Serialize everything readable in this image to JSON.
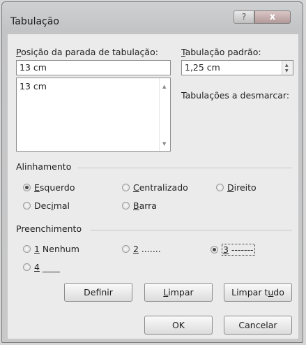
{
  "dialog": {
    "title": "Tabulação",
    "help_glyph": "?",
    "close_glyph": "x"
  },
  "tab_stop": {
    "label_first": "P",
    "label_rest": "osição da parada de tabulação:",
    "value": "13 cm",
    "list": [
      "13 cm"
    ]
  },
  "default_tab": {
    "label_first": "T",
    "label_rest": "abulação padrão:",
    "value": "1,25 cm"
  },
  "clear_label": "Tabulações a desmarcar:",
  "alignment": {
    "legend": "Alinhamento",
    "options": [
      {
        "key": "E",
        "rest": "squerdo",
        "pre": "",
        "checked": true
      },
      {
        "key": "C",
        "rest": "entralizado",
        "pre": "",
        "checked": false
      },
      {
        "key": "D",
        "rest": "ireito",
        "pre": "",
        "checked": false
      },
      {
        "key": "i",
        "rest": "mal",
        "pre": "Dec",
        "checked": false
      },
      {
        "key": "B",
        "rest": "arra",
        "pre": "",
        "checked": false
      }
    ]
  },
  "leader": {
    "legend": "Preenchimento",
    "options": [
      {
        "key": "1",
        "rest": " Nenhum",
        "checked": false
      },
      {
        "key": "2",
        "rest": " .......",
        "checked": false
      },
      {
        "key": "3",
        "rest": " -------",
        "checked": true
      },
      {
        "key": "4",
        "rest": " ____",
        "checked": false
      }
    ]
  },
  "buttons": {
    "set_pre": "Def",
    "set_key": "i",
    "set_rest": "nir",
    "clear_key": "L",
    "clear_rest": "impar",
    "clear_all_pre": "Limpar t",
    "clear_all_key": "u",
    "clear_all_rest": "do",
    "ok": "OK",
    "cancel": "Cancelar"
  }
}
